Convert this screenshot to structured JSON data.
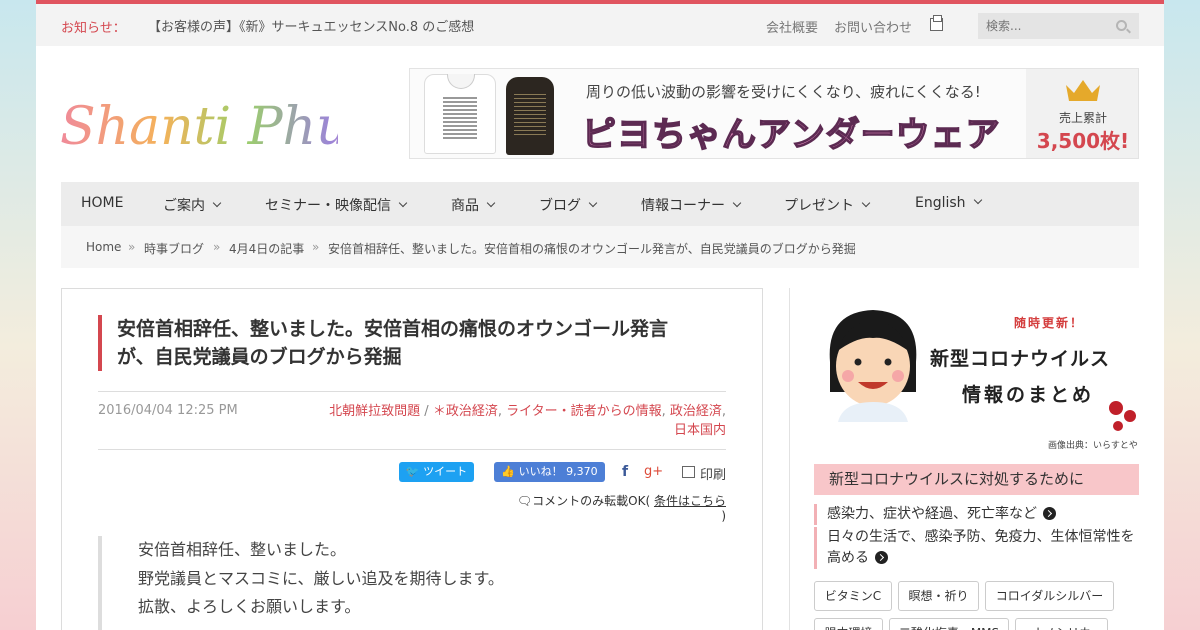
{
  "notice": {
    "label": "お知らせ：",
    "text": "【お客様の声】《新》サーキュエッセンスNo.8 のご感想",
    "links": [
      "会社概要",
      "お問い合わせ"
    ],
    "search_placeholder": "検索..."
  },
  "logo": {
    "text": "Shanti Phula"
  },
  "banner": {
    "subtitle": "周りの低い波動の影響を受けにくくなり、疲れにくくなる!",
    "title": "ピヨちゃんアンダーウェア",
    "sales_label": "売上累計",
    "sales_value": "3,500枚!"
  },
  "nav": [
    "HOME",
    "ご案内",
    "セミナー・映像配信",
    "商品",
    "ブログ",
    "情報コーナー",
    "プレゼント",
    "English"
  ],
  "breadcrumb": [
    "Home",
    "時事ブログ",
    "4月4日の記事",
    "安倍首相辞任、整いました。安倍首相の痛恨のオウンゴール発言が、自民党議員のブログから発掘"
  ],
  "article": {
    "title": "安倍首相辞任、整いました。安倍首相の痛恨のオウンゴール発言が、自民党議員のブログから発掘",
    "date": "2016/04/04 12:25 PM",
    "categories": [
      "北朝鮮拉致問題",
      "＊政治経済",
      "ライター・読者からの情報",
      "政治経済",
      "日本国内"
    ],
    "share": {
      "tweet": "ツイート",
      "like": "いいね！",
      "like_count": "9,370",
      "print": "印刷"
    },
    "comment_notice": "コメントのみ転載OK(",
    "comment_link": "条件はこちら",
    "comment_end": ")",
    "quote": [
      "安倍首相辞任、整いました。",
      "野党議員とマスコミに、厳しい追及を期待します。",
      "拡散、よろしくお願いします。"
    ]
  },
  "sidebar": {
    "corona_banner": {
      "update": "随時更新！",
      "line1": "新型コロナウイルス",
      "line2": "情報のまとめ",
      "credit": "画像出典：いらすとや"
    },
    "heading": "新型コロナウイルスに対処するために",
    "links": [
      "感染力、症状や経過、死亡率など",
      "日々の生活で、感染予防、免疫力、生体恒常性を高める"
    ],
    "tags": [
      "ビタミンC",
      "瞑想・祈り",
      "コロイダルシルバー",
      "腸内環境",
      "二酸化塩素・MMS",
      "ナノシリカ"
    ]
  },
  "colors": {
    "accent": "#d4474f",
    "twitter": "#1da1f2",
    "facebook": "#4d7fd6"
  }
}
